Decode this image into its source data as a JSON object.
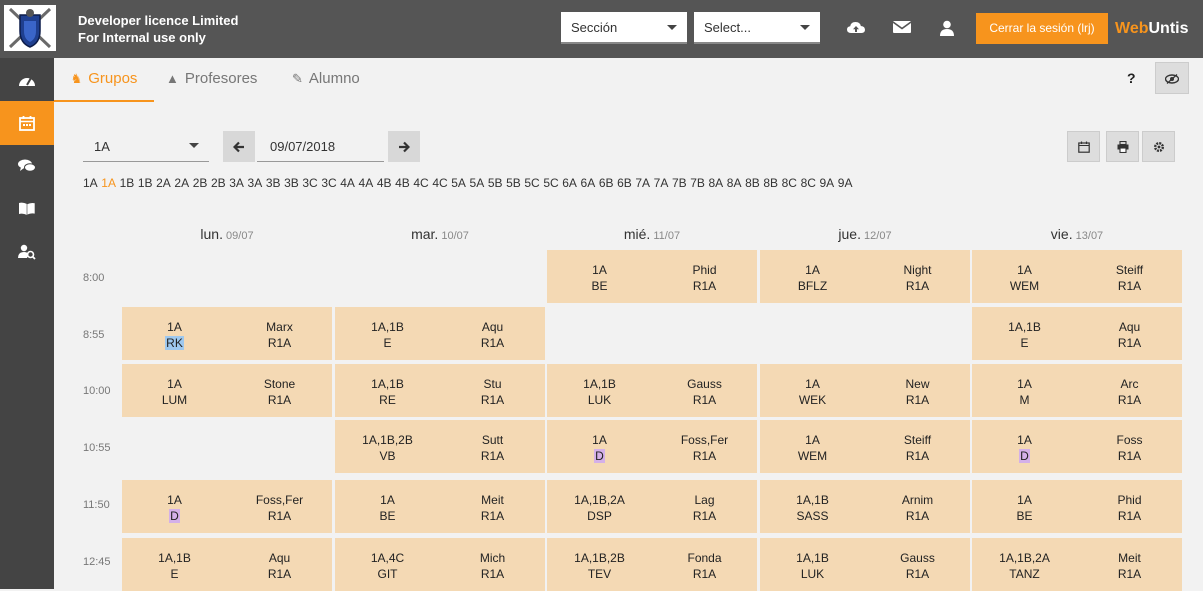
{
  "header": {
    "licence_line1": "Developer licence Limited",
    "licence_line2": "For Internal use only",
    "section_select": "Sección",
    "select_placeholder": "Select...",
    "logout_label": "Cerrar la sesión (lrj)",
    "brand_web": "Web",
    "brand_untis": "Untis",
    "icons": [
      "cloud-upload-icon",
      "mail-icon",
      "user-icon"
    ]
  },
  "sidebar": {
    "items": [
      "dashboard-icon",
      "calendar-icon",
      "chat-icon",
      "book-icon",
      "user-search-icon"
    ],
    "active": "calendar-icon"
  },
  "tabs": [
    {
      "label": "Grupos",
      "icon": "groups-icon",
      "active": true
    },
    {
      "label": "Profesores",
      "icon": "graduation-cap-icon",
      "active": false
    },
    {
      "label": "Alumno",
      "icon": "student-icon",
      "active": false
    }
  ],
  "help_label": "?",
  "controls": {
    "class_value": "1A",
    "date_value": "09/07/2018",
    "prev_icon": "arrow-left-icon",
    "next_icon": "arrow-right-icon",
    "tool_icons": [
      "calendar-17-icon",
      "print-icon",
      "gear-icon"
    ]
  },
  "class_links": [
    "1A",
    "1A",
    "1B",
    "1B",
    "2A",
    "2A",
    "2B",
    "2B",
    "3A",
    "3A",
    "3B",
    "3B",
    "3C",
    "3C",
    "4A",
    "4A",
    "4B",
    "4B",
    "4C",
    "4C",
    "5A",
    "5A",
    "5B",
    "5B",
    "5C",
    "5C",
    "6A",
    "6A",
    "6B",
    "6B",
    "7A",
    "7A",
    "7B",
    "7B",
    "8A",
    "8A",
    "8B",
    "8B",
    "8C",
    "8C",
    "9A",
    "9A"
  ],
  "selected_class_link_index": 1,
  "days": [
    {
      "name": "lun.",
      "date": "09/07"
    },
    {
      "name": "mar.",
      "date": "10/07"
    },
    {
      "name": "mié.",
      "date": "11/07"
    },
    {
      "name": "jue.",
      "date": "12/07"
    },
    {
      "name": "vie.",
      "date": "13/07"
    }
  ],
  "times": [
    "8:00",
    "8:55",
    "10:00",
    "10:55",
    "11:50",
    "12:45"
  ],
  "lessons": [
    {
      "day": 2,
      "slot": 0,
      "classes": "1A",
      "teacher": "Phid",
      "subject": "BE",
      "room": "R1A"
    },
    {
      "day": 3,
      "slot": 0,
      "classes": "1A",
      "teacher": "Night",
      "subject": "BFLZ",
      "room": "R1A"
    },
    {
      "day": 4,
      "slot": 0,
      "classes": "1A",
      "teacher": "Steiff",
      "subject": "WEM",
      "room": "R1A"
    },
    {
      "day": 0,
      "slot": 1,
      "classes": "1A",
      "teacher": "Marx",
      "subject": "RK",
      "room": "R1A",
      "hl": "blue"
    },
    {
      "day": 1,
      "slot": 1,
      "classes": "1A,1B",
      "teacher": "Aqu",
      "subject": "E",
      "room": "R1A"
    },
    {
      "day": 4,
      "slot": 1,
      "classes": "1A,1B",
      "teacher": "Aqu",
      "subject": "E",
      "room": "R1A"
    },
    {
      "day": 0,
      "slot": 2,
      "classes": "1A",
      "teacher": "Stone",
      "subject": "LUM",
      "room": "R1A"
    },
    {
      "day": 1,
      "slot": 2,
      "classes": "1A,1B",
      "teacher": "Stu",
      "subject": "RE",
      "room": "R1A"
    },
    {
      "day": 2,
      "slot": 2,
      "classes": "1A,1B",
      "teacher": "Gauss",
      "subject": "LUK",
      "room": "R1A"
    },
    {
      "day": 3,
      "slot": 2,
      "classes": "1A",
      "teacher": "New",
      "subject": "WEK",
      "room": "R1A"
    },
    {
      "day": 4,
      "slot": 2,
      "classes": "1A",
      "teacher": "Arc",
      "subject": "M",
      "room": "R1A"
    },
    {
      "day": 1,
      "slot": 3,
      "classes": "1A,1B,2B",
      "teacher": "Sutt",
      "subject": "VB",
      "room": "R1A"
    },
    {
      "day": 2,
      "slot": 3,
      "classes": "1A",
      "teacher": "Foss,Fer",
      "subject": "D",
      "room": "R1A",
      "hl": "purple"
    },
    {
      "day": 3,
      "slot": 3,
      "classes": "1A",
      "teacher": "Steiff",
      "subject": "WEM",
      "room": "R1A"
    },
    {
      "day": 4,
      "slot": 3,
      "classes": "1A",
      "teacher": "Foss",
      "subject": "D",
      "room": "R1A",
      "hl": "purple"
    },
    {
      "day": 0,
      "slot": 4,
      "classes": "1A",
      "teacher": "Foss,Fer",
      "subject": "D",
      "room": "R1A",
      "hl": "purple"
    },
    {
      "day": 1,
      "slot": 4,
      "classes": "1A",
      "teacher": "Meit",
      "subject": "BE",
      "room": "R1A"
    },
    {
      "day": 2,
      "slot": 4,
      "classes": "1A,1B,2A",
      "teacher": "Lag",
      "subject": "DSP",
      "room": "R1A"
    },
    {
      "day": 3,
      "slot": 4,
      "classes": "1A,1B",
      "teacher": "Arnim",
      "subject": "SASS",
      "room": "R1A"
    },
    {
      "day": 4,
      "slot": 4,
      "classes": "1A",
      "teacher": "Phid",
      "subject": "BE",
      "room": "R1A"
    },
    {
      "day": 0,
      "slot": 5,
      "classes": "1A,1B",
      "teacher": "Aqu",
      "subject": "E",
      "room": "R1A"
    },
    {
      "day": 1,
      "slot": 5,
      "classes": "1A,4C",
      "teacher": "Mich",
      "subject": "GIT",
      "room": "R1A"
    },
    {
      "day": 2,
      "slot": 5,
      "classes": "1A,1B,2B",
      "teacher": "Fonda",
      "subject": "TEV",
      "room": "R1A"
    },
    {
      "day": 3,
      "slot": 5,
      "classes": "1A,1B",
      "teacher": "Gauss",
      "subject": "LUK",
      "room": "R1A"
    },
    {
      "day": 4,
      "slot": 5,
      "classes": "1A,1B,2A",
      "teacher": "Meit",
      "subject": "TANZ",
      "room": "R1A"
    }
  ],
  "colors": {
    "accent": "#f7941d",
    "header_bg": "#555555",
    "sidebar_bg": "#444444",
    "lesson_bg": "#f4d9b4",
    "highlight_blue": "#9ec8ee",
    "highlight_purple": "#d4b0e8"
  }
}
